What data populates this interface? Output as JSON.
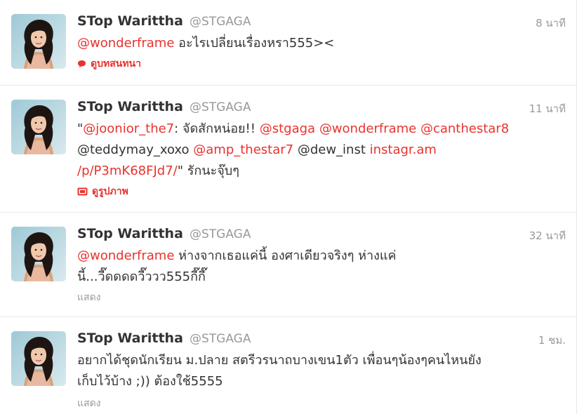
{
  "colors": {
    "link": "#e8332e",
    "name": "#333333",
    "meta": "#999999",
    "divider": "#e8e8e8"
  },
  "tweets": [
    {
      "fullname": "STop Warittha",
      "username": "@STGAGA",
      "time": "8 นาที",
      "lines": [
        [
          {
            "type": "mention",
            "text": "@wonderframe"
          },
          {
            "type": "text",
            "text": " อะไรเปลี่ยนเรื่องหรา555><"
          }
        ]
      ],
      "action": {
        "label": "ดูบทสนทนา",
        "icon": "speech-bubble-icon",
        "style": "link"
      }
    },
    {
      "fullname": "STop Warittha",
      "username": "@STGAGA",
      "time": "11 นาที",
      "lines": [
        [
          {
            "type": "text",
            "text": "\""
          },
          {
            "type": "mention",
            "text": "@joonior_the7"
          },
          {
            "type": "text",
            "text": ": จัดสักหน่อย!! "
          },
          {
            "type": "mention",
            "text": "@stgaga"
          },
          {
            "type": "text",
            "text": " "
          },
          {
            "type": "mention",
            "text": "@wonderframe"
          },
          {
            "type": "text",
            "text": " "
          },
          {
            "type": "mention",
            "text": "@canthestar8"
          }
        ],
        [
          {
            "type": "text",
            "text": "@teddymay_xoxo "
          },
          {
            "type": "mention",
            "text": "@amp_thestar7"
          },
          {
            "type": "text",
            "text": " @dew_inst "
          },
          {
            "type": "link",
            "text": "instagr.am"
          }
        ],
        [
          {
            "type": "link",
            "text": "/p/P3mK68FJd7/"
          },
          {
            "type": "text",
            "text": "\" รักนะจุ๊บๆ"
          }
        ]
      ],
      "action": {
        "label": "ดูรูปภาพ",
        "icon": "photo-icon",
        "style": "link"
      }
    },
    {
      "fullname": "STop Warittha",
      "username": "@STGAGA",
      "time": "32 นาที",
      "lines": [
        [
          {
            "type": "mention",
            "text": "@wonderframe"
          },
          {
            "type": "text",
            "text": " ห่างจากเธอแค่นี้ องศาเดียวจริงๆ ห่างแค่"
          }
        ],
        [
          {
            "type": "text",
            "text": "นี้...วี๊ดดดดวี๊ววว555กี๊กี๊"
          }
        ]
      ],
      "action": {
        "label": "แสดง",
        "icon": "",
        "style": "gray"
      }
    },
    {
      "fullname": "STop Warittha",
      "username": "@STGAGA",
      "time": "1 ชม.",
      "lines": [
        [
          {
            "type": "text",
            "text": "อยากได้ชุดนักเรียน ม.ปลาย สตรีวรนาถบางเขน1ตัว เพื่อนๆน้องๆคนไหนยัง"
          }
        ],
        [
          {
            "type": "text",
            "text": "เก็บไว้บ้าง ;)) ต้องใช้5555"
          }
        ]
      ],
      "action": {
        "label": "แสดง",
        "icon": "",
        "style": "gray"
      }
    }
  ]
}
